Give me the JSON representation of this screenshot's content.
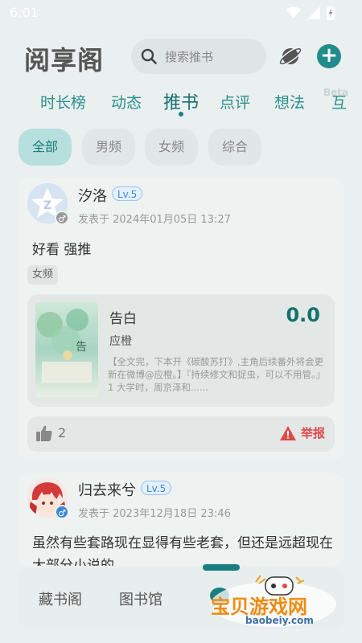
{
  "status_bar": {
    "time": "6:01"
  },
  "header": {
    "title": "阅享阁",
    "search_placeholder": "搜索推书"
  },
  "tabs": [
    {
      "label": "时长榜"
    },
    {
      "label": "动态"
    },
    {
      "label": "推书",
      "active": true
    },
    {
      "label": "点评"
    },
    {
      "label": "想法"
    },
    {
      "label": "互"
    }
  ],
  "beta_label": "Beta",
  "filters": [
    {
      "label": "全部",
      "active": true
    },
    {
      "label": "男频"
    },
    {
      "label": "女频"
    },
    {
      "label": "综合"
    }
  ],
  "posts": [
    {
      "username": "汐洛",
      "level": "Lv.5",
      "gender": "♂",
      "time": "发表于 2024年01月05日 13:27",
      "content": "好看 强推",
      "tag": "女频",
      "book": {
        "title": "告白",
        "author": "应橙",
        "score": "0.0",
        "description": "【全文完，下本开《碳酸苏打》,主角后续番外将会更新在微博@应橙。】『持续修文和捉虫，可以不用管。』1 大学时，周京泽和......"
      },
      "likes": "2",
      "report_label": "举报"
    },
    {
      "username": "归去来兮",
      "level": "Lv.5",
      "gender": "♂",
      "time": "发表于 2023年12月18日 23:46",
      "content": "虽然有些套路现在显得有些老套，但还是远超现在大部分小说的"
    }
  ],
  "bottom_nav": [
    {
      "label": "藏书阁"
    },
    {
      "label": "图书馆"
    }
  ],
  "watermark": {
    "text": "宝贝游戏网",
    "url": "baobeiy.com"
  },
  "colors": {
    "accent": "#218c8c",
    "tab_text": "#2a8f8f",
    "report": "#e04a4a"
  }
}
